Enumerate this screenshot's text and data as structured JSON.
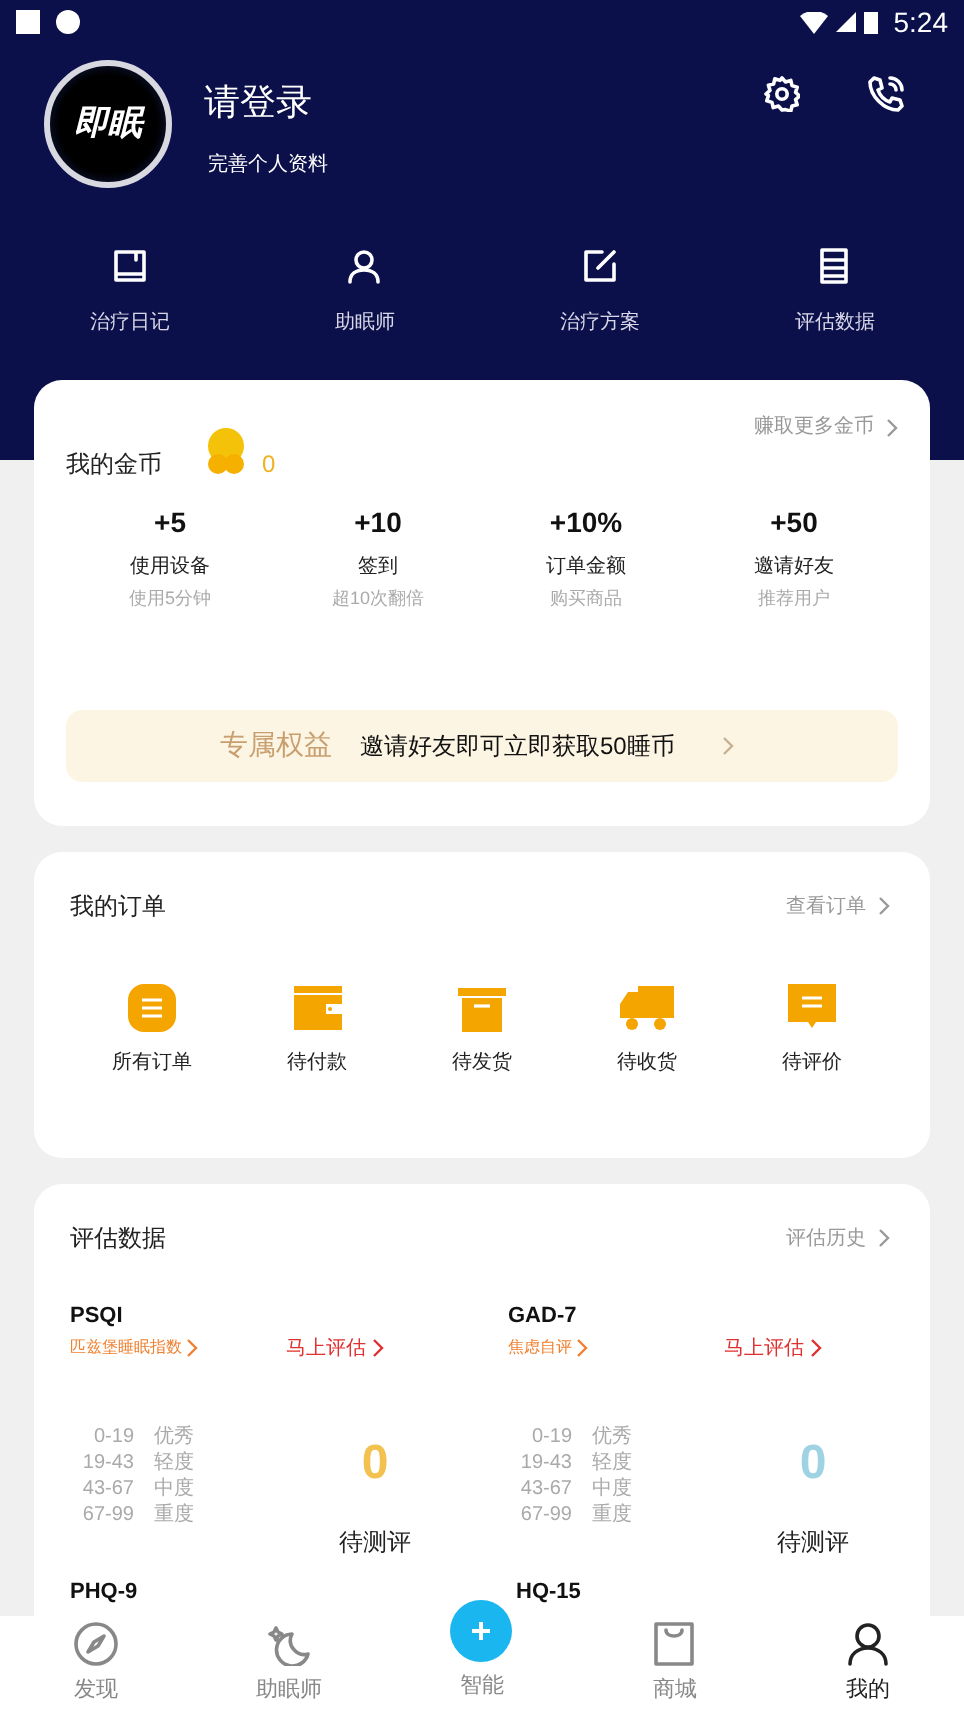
{
  "status_bar": {
    "time": "5:24"
  },
  "profile": {
    "name": "请登录",
    "subtitle": "完善个人资料",
    "logo_text": "即眠"
  },
  "shortcuts": [
    {
      "label": "治疗日记",
      "kind": "diary"
    },
    {
      "label": "助眠师",
      "kind": "person"
    },
    {
      "label": "治疗方案",
      "kind": "edit"
    },
    {
      "label": "评估数据",
      "kind": "list"
    }
  ],
  "coins": {
    "title": "我的金币",
    "count": "0",
    "more": "赚取更多金币",
    "tasks": [
      {
        "value": "+5",
        "label": "使用设备",
        "hint": "使用5分钟"
      },
      {
        "value": "+10",
        "label": "签到",
        "hint": "超10次翻倍"
      },
      {
        "value": "+10%",
        "label": "订单金额",
        "hint": "购买商品"
      },
      {
        "value": "+50",
        "label": "邀请好友",
        "hint": "推荐用户"
      }
    ],
    "banner": {
      "tag": "专属权益",
      "text": "邀请好友即可立即获取50睡币"
    }
  },
  "orders": {
    "title": "我的订单",
    "more": "查看订单",
    "items": [
      {
        "label": "所有订单",
        "kind": "all"
      },
      {
        "label": "待付款",
        "kind": "wallet"
      },
      {
        "label": "待发货",
        "kind": "box"
      },
      {
        "label": "待收货",
        "kind": "truck"
      },
      {
        "label": "待评价",
        "kind": "comment"
      }
    ]
  },
  "assessments": {
    "title": "评估数据",
    "more": "评估历史",
    "items": [
      {
        "name": "PSQI",
        "desc": "匹兹堡睡眠指数",
        "action": "马上评估",
        "score": "0",
        "color": "#f2c14e",
        "status": "待测评",
        "ranges": [
          [
            "0-19",
            "优秀"
          ],
          [
            "19-43",
            "轻度"
          ],
          [
            "43-67",
            "中度"
          ],
          [
            "67-99",
            "重度"
          ]
        ]
      },
      {
        "name": "GAD-7",
        "desc": "焦虑自评",
        "action": "马上评估",
        "score": "0",
        "color": "#9fd3e3",
        "status": "待测评",
        "ranges": [
          [
            "0-19",
            "优秀"
          ],
          [
            "19-43",
            "轻度"
          ],
          [
            "43-67",
            "中度"
          ],
          [
            "67-99",
            "重度"
          ]
        ]
      }
    ],
    "partial": [
      "PHQ-9",
      "HQ-15"
    ]
  },
  "tabs": [
    {
      "label": "发现",
      "kind": "compass",
      "selected": false
    },
    {
      "label": "助眠师",
      "kind": "moon",
      "selected": false
    },
    {
      "label": "智能",
      "kind": "fab",
      "selected": false
    },
    {
      "label": "商城",
      "kind": "bag",
      "selected": false
    },
    {
      "label": "我的",
      "kind": "user",
      "selected": true
    }
  ]
}
